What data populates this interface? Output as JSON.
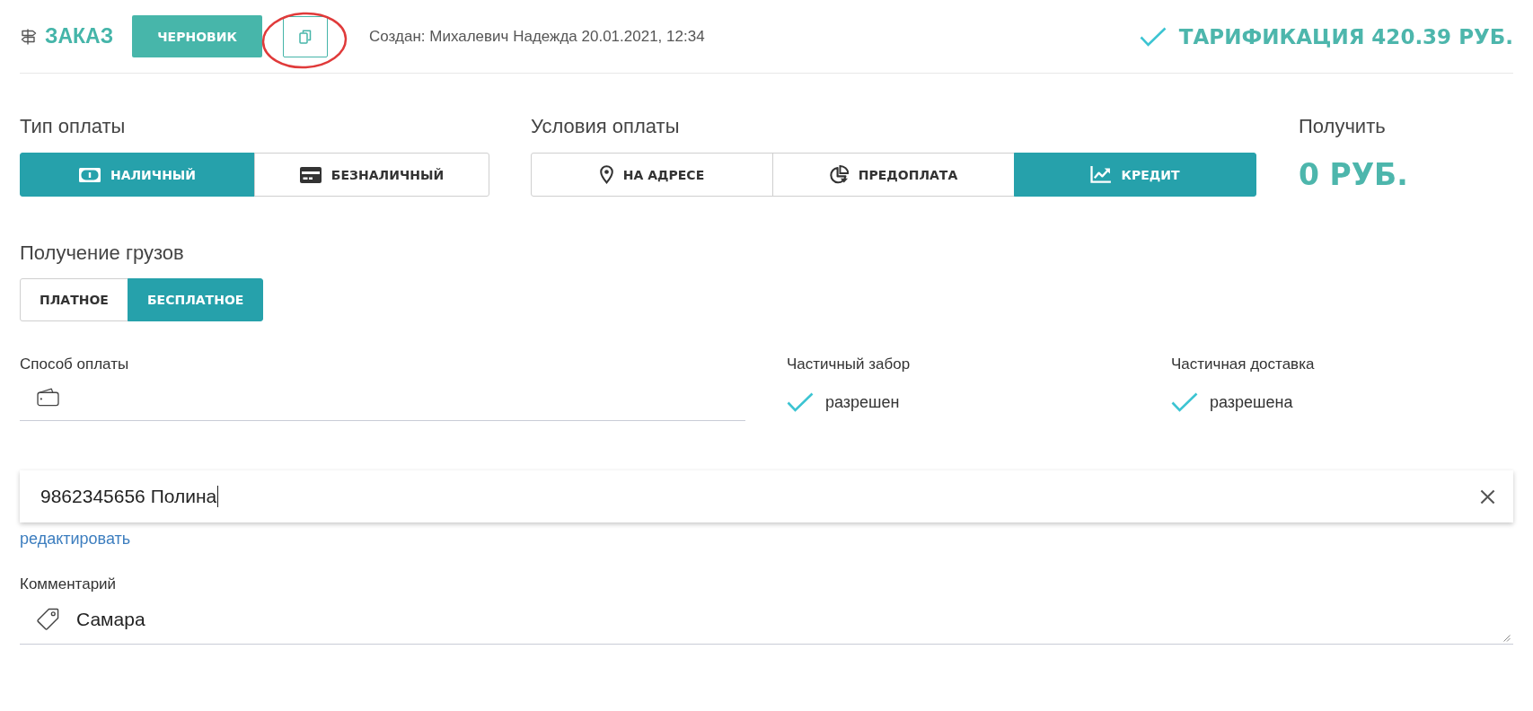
{
  "header": {
    "title": "ЗАКАЗ",
    "status_button": "ЧЕРНОВИК",
    "copy_button": {
      "highlighted": true
    },
    "created": "Создан: Михалевич Надежда 20.01.2021, 12:34",
    "tariff": "ТАРИФИКАЦИЯ 420.39 РУБ."
  },
  "payment_type": {
    "label": "Тип оплаты",
    "options": [
      {
        "label": "НАЛИЧНЫЙ",
        "selected": true
      },
      {
        "label": "БЕЗНАЛИЧНЫЙ",
        "selected": false
      }
    ]
  },
  "payment_terms": {
    "label": "Условия оплаты",
    "options": [
      {
        "label": "НА АДРЕСЕ",
        "selected": false
      },
      {
        "label": "ПРЕДОПЛАТА",
        "selected": false
      },
      {
        "label": "КРЕДИТ",
        "selected": true
      }
    ]
  },
  "receive": {
    "label": "Получить",
    "amount": "0 РУБ."
  },
  "cargo_receipt": {
    "label": "Получение грузов",
    "options": [
      {
        "label": "ПЛАТНОЕ",
        "selected": false
      },
      {
        "label": "БЕСПЛАТНОЕ",
        "selected": true
      }
    ]
  },
  "payment_method": {
    "label": "Способ оплаты"
  },
  "partial": [
    {
      "label": "Частичный забор",
      "checked": true,
      "value": "разрешен"
    },
    {
      "label": "Частичная доставка",
      "checked": true,
      "value": "разрешена"
    }
  ],
  "contact": {
    "value": "9862345656 Полина",
    "edit_link": "редактировать"
  },
  "comment": {
    "label": "Комментарий",
    "value": "Самара"
  }
}
